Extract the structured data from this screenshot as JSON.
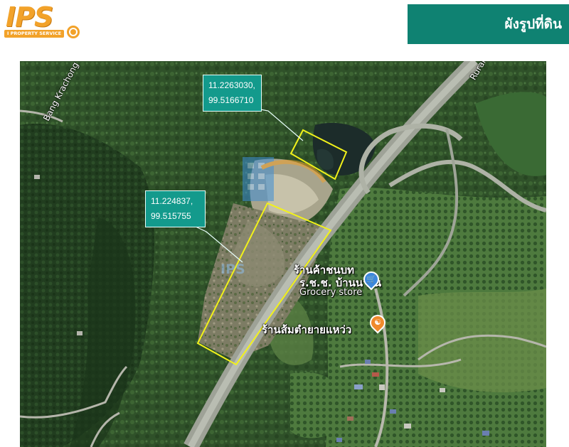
{
  "header": {
    "logo_text": "IPS",
    "logo_tagline": "I PROPERTY SERVICE",
    "title": "ผังรูปที่ดิน"
  },
  "colors": {
    "header_box": "#0f8272",
    "logo": "#f2a22a",
    "plot_outline": "#f2f21a",
    "callout": "#139a8c"
  },
  "map": {
    "place_labels": {
      "bang_krachong": "Bang Krachong",
      "rural_road": "Rural R",
      "store_line1": "ร้านค้าชนบท",
      "store_line2": "ร.ช.ช. บ้านนาใน",
      "store_category": "Grocery store",
      "restaurant": "ร้านส้มตำยายแหว่ว"
    },
    "icons": {
      "store": "shopping-cart-icon",
      "restaurant": "fork-knife-icon",
      "watermark": "building-watermark-icon"
    },
    "watermark_text": "IPS"
  },
  "callouts": [
    {
      "lat": "11.2263030,",
      "lng": "99.5166710"
    },
    {
      "lat": "11.224837,",
      "lng": "99.515755"
    }
  ]
}
